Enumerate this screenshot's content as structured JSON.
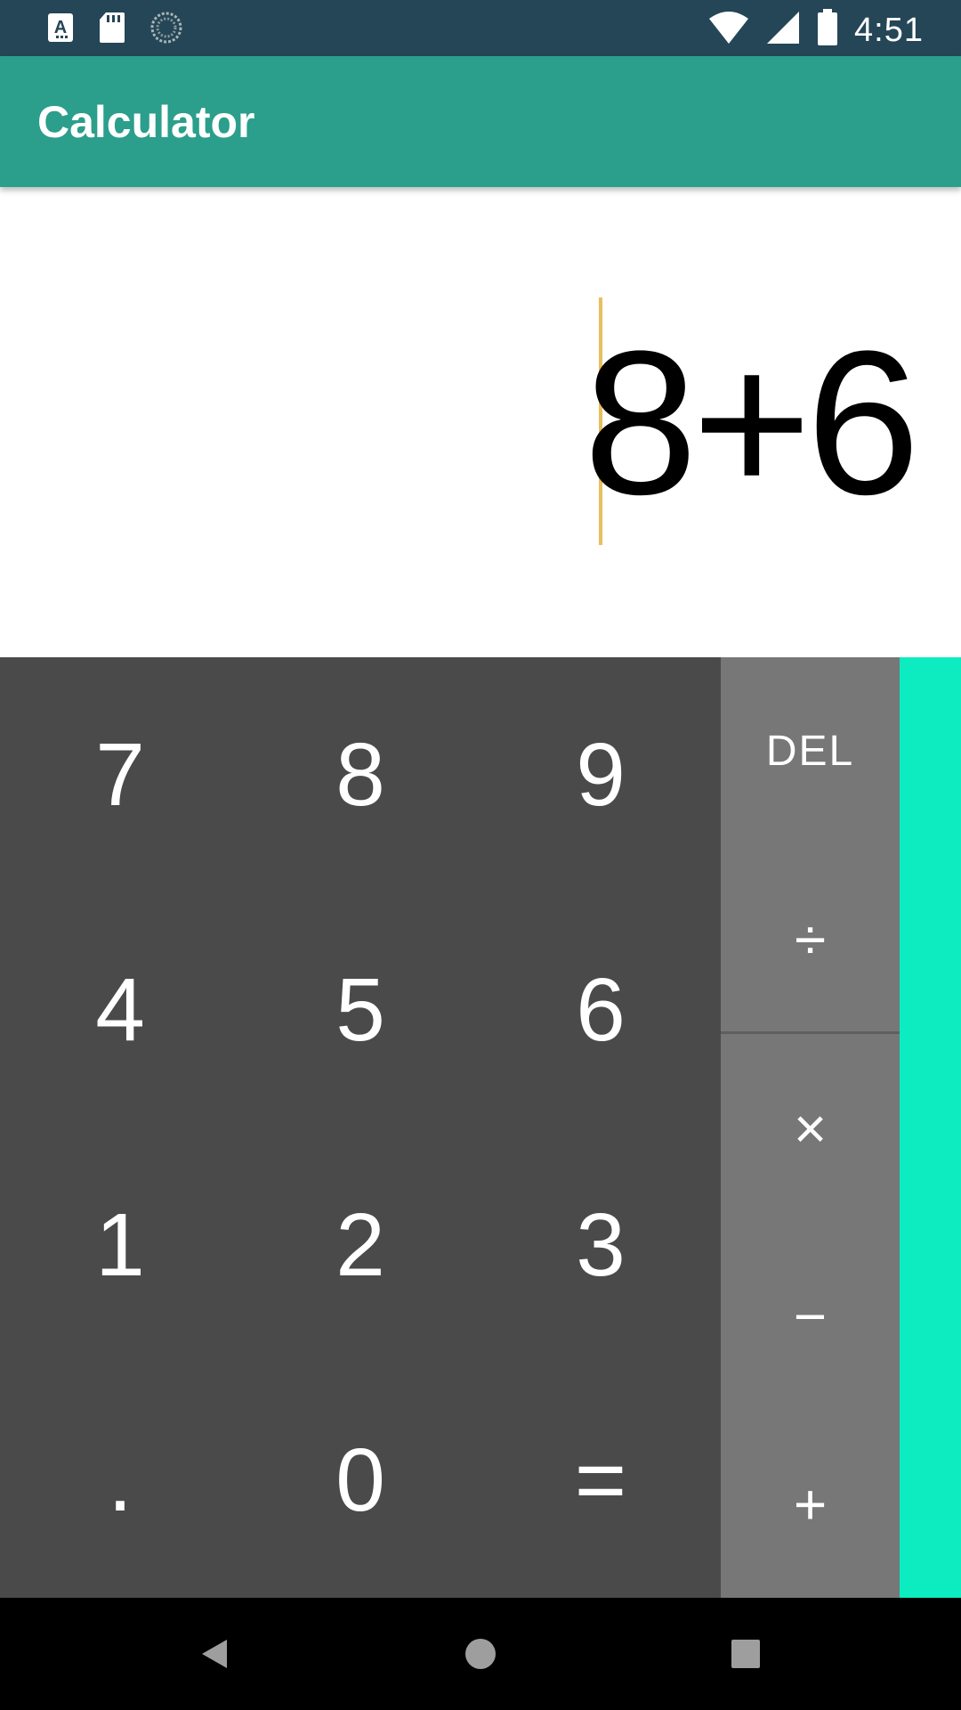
{
  "status_bar": {
    "time": "4:51",
    "left_icons": [
      "font-notification-icon",
      "sd-card-icon",
      "sync-spinner-icon"
    ],
    "right_icons": [
      "wifi-icon",
      "cell-signal-icon",
      "battery-icon"
    ]
  },
  "app_bar": {
    "title": "Calculator"
  },
  "display": {
    "expression": "8+6",
    "cursor_color": "#e8bf5d"
  },
  "keypad": {
    "digits": [
      {
        "label": "7"
      },
      {
        "label": "8"
      },
      {
        "label": "9"
      },
      {
        "label": "4"
      },
      {
        "label": "5"
      },
      {
        "label": "6"
      },
      {
        "label": "1"
      },
      {
        "label": "2"
      },
      {
        "label": "3"
      },
      {
        "label": "."
      },
      {
        "label": "0"
      },
      {
        "label": "="
      }
    ]
  },
  "operators": {
    "del": "DEL",
    "divide": "÷",
    "multiply": "×",
    "minus": "−",
    "plus": "+"
  },
  "colors": {
    "status_bar": "#254656",
    "app_bar": "#2b9e8c",
    "keypad": "#4a4a4a",
    "operators": "#777777",
    "advanced_panel": "#0cecc0"
  },
  "nav_bar": {
    "buttons": [
      "back-icon",
      "home-icon",
      "recents-icon"
    ]
  }
}
